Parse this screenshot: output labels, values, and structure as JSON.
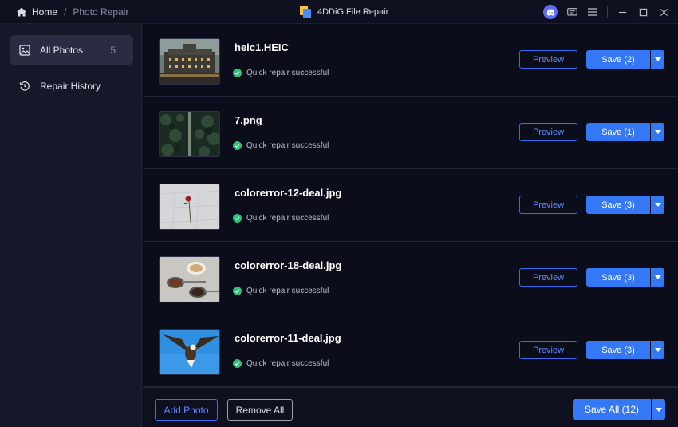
{
  "breadcrumb": {
    "home": "Home",
    "separator": "/",
    "current": "Photo Repair"
  },
  "app": {
    "title": "4DDiG File Repair"
  },
  "sidebar": {
    "items": [
      {
        "label": "All Photos",
        "count": "5",
        "icon": "image-icon"
      },
      {
        "label": "Repair History",
        "icon": "history-icon"
      }
    ]
  },
  "photos": [
    {
      "name": "heic1.HEIC",
      "status": "Quick repair successful",
      "preview": "Preview",
      "save": "Save (2)"
    },
    {
      "name": "7.png",
      "status": "Quick repair successful",
      "preview": "Preview",
      "save": "Save (1)"
    },
    {
      "name": "colorerror-12-deal.jpg",
      "status": "Quick repair successful",
      "preview": "Preview",
      "save": "Save (3)"
    },
    {
      "name": "colorerror-18-deal.jpg",
      "status": "Quick repair successful",
      "preview": "Preview",
      "save": "Save (3)"
    },
    {
      "name": "colorerror-11-deal.jpg",
      "status": "Quick repair successful",
      "preview": "Preview",
      "save": "Save (3)"
    }
  ],
  "footer": {
    "add": "Add Photo",
    "remove": "Remove All",
    "save_all": "Save All (12)"
  },
  "colors": {
    "accent": "#3478f6",
    "success": "#2bc27a",
    "background": "#0b0d1a",
    "sidebar": "#161829"
  }
}
